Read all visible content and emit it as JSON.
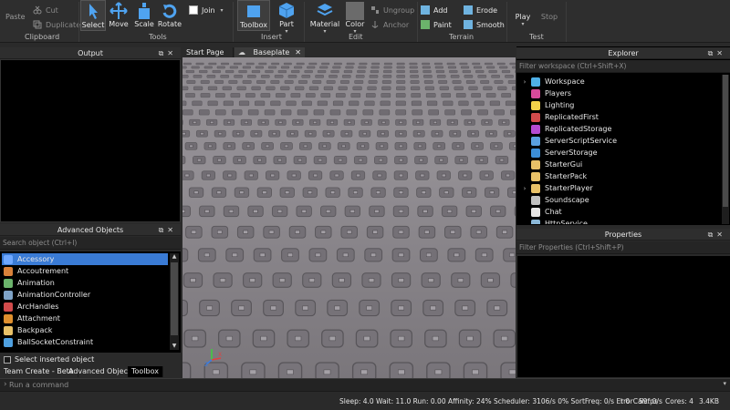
{
  "ribbon": {
    "clipboard": {
      "paste": "Paste",
      "cut": "Cut",
      "duplicate": "Duplicate",
      "label": "Clipboard"
    },
    "tools": {
      "select": "Select",
      "move": "Move",
      "scale": "Scale",
      "rotate": "Rotate",
      "join": "Join",
      "label": "Tools"
    },
    "insert": {
      "toolbox": "Toolbox",
      "part": "Part",
      "label": "Insert"
    },
    "edit": {
      "material": "Material",
      "color": "Color",
      "ungroup": "Ungroup",
      "anchor": "Anchor",
      "label": "Edit"
    },
    "terrain": {
      "add": "Add",
      "paint": "Paint",
      "erode": "Erode",
      "smooth": "Smooth",
      "label": "Terrain"
    },
    "test": {
      "play": "Play",
      "stop": "Stop",
      "label": "Test"
    }
  },
  "output": {
    "title": "Output"
  },
  "advanced_objects": {
    "title": "Advanced Objects",
    "search_placeholder": "Search object (Ctrl+I)",
    "items": [
      {
        "label": "Accessory",
        "color": "#6fa8ff"
      },
      {
        "label": "Accoutrement",
        "color": "#d9823b"
      },
      {
        "label": "Animation",
        "color": "#6bb36b"
      },
      {
        "label": "AnimationController",
        "color": "#7fa3c7"
      },
      {
        "label": "ArcHandles",
        "color": "#d24b4b"
      },
      {
        "label": "Attachment",
        "color": "#e0902e"
      },
      {
        "label": "Backpack",
        "color": "#e8c168"
      },
      {
        "label": "BallSocketConstraint",
        "color": "#4fa0e0"
      }
    ],
    "select_inserted": "Select inserted object"
  },
  "tabs": {
    "start_page": "Start Page",
    "baseplate": "Baseplate"
  },
  "explorer": {
    "title": "Explorer",
    "filter_placeholder": "Filter workspace (Ctrl+Shift+X)",
    "items": [
      {
        "label": "Workspace",
        "expandable": true,
        "color": "#4fb0e8"
      },
      {
        "label": "Players",
        "expandable": false,
        "color": "#d84a9a"
      },
      {
        "label": "Lighting",
        "expandable": false,
        "color": "#f2d14a"
      },
      {
        "label": "ReplicatedFirst",
        "expandable": false,
        "color": "#d24b4b"
      },
      {
        "label": "ReplicatedStorage",
        "expandable": false,
        "color": "#b54bd2"
      },
      {
        "label": "ServerScriptService",
        "expandable": false,
        "color": "#5aa0e0"
      },
      {
        "label": "ServerStorage",
        "expandable": false,
        "color": "#3c8fd9"
      },
      {
        "label": "StarterGui",
        "expandable": false,
        "color": "#e8c168"
      },
      {
        "label": "StarterPack",
        "expandable": false,
        "color": "#e8c168"
      },
      {
        "label": "StarterPlayer",
        "expandable": true,
        "color": "#e8c168"
      },
      {
        "label": "Soundscape",
        "expandable": false,
        "color": "#c0c0c0"
      },
      {
        "label": "Chat",
        "expandable": false,
        "color": "#e6e6e6"
      },
      {
        "label": "HttpService",
        "expandable": false,
        "color": "#8bb8d8"
      }
    ]
  },
  "properties": {
    "title": "Properties",
    "filter_placeholder": "Filter Properties (Ctrl+Shift+P)"
  },
  "bottom_tabs": [
    "Team Create - Beta",
    "Advanced Objects",
    "Toolbox"
  ],
  "command": {
    "placeholder": "Run a command"
  },
  "status": {
    "stats": "Sleep: 4.0 Wait: 11.0 Run: 0.00 Affinity: 24% Scheduler: 3106/s 0% SortFreq: 0/s ErrorCalc: 0/s",
    "t": "t 0",
    "fps": "59fps",
    "cores": "Cores: 4",
    "mem": "3.4KB"
  }
}
